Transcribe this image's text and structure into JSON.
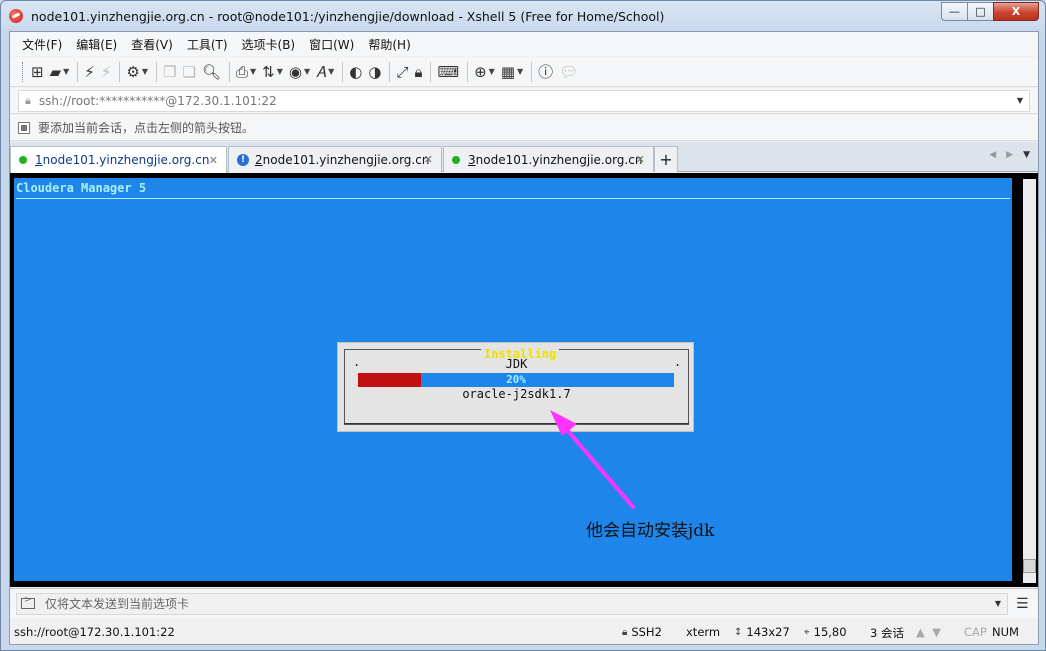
{
  "window": {
    "title": "node101.yinzhengjie.org.cn - root@node101:/yinzhengjie/download - Xshell 5 (Free for Home/School)",
    "controls": {
      "minimize": "—",
      "maximize": "□",
      "close": "X"
    }
  },
  "menubar": [
    {
      "label": "文件(F)"
    },
    {
      "label": "编辑(E)"
    },
    {
      "label": "查看(V)"
    },
    {
      "label": "工具(T)"
    },
    {
      "label": "选项卡(B)"
    },
    {
      "label": "窗口(W)"
    },
    {
      "label": "帮助(H)"
    }
  ],
  "address": {
    "value": "ssh://root:***********@172.30.1.101:22"
  },
  "hint": {
    "text": "要添加当前会话，点击左侧的箭头按钮。"
  },
  "tabs": [
    {
      "label_num": "1",
      "label_host": " node101.yinzhengjie.org.cn",
      "status": "connected",
      "active": true
    },
    {
      "label_num": "2",
      "label_host": " node101.yinzhengjie.org.cn",
      "status": "warning",
      "active": false
    },
    {
      "label_num": "3",
      "label_host": " node101.yinzhengjie.org.cn",
      "status": "connected",
      "active": false
    }
  ],
  "terminal": {
    "header": "Cloudera Manager 5",
    "dialog": {
      "title": "Installing",
      "item": "JDK",
      "progress_percent": 20,
      "progress_label": "20%",
      "package": "oracle-j2sdk1.7"
    }
  },
  "annotation": {
    "text": "他会自动安装jdk",
    "color": "#ff33ff"
  },
  "compose": {
    "placeholder": "仅将文本发送到当前选项卡"
  },
  "status": {
    "connection": "ssh://root@172.30.1.101:22",
    "protocol": "SSH2",
    "terminal_type": "xterm",
    "size": "143x27",
    "cursor": "15,80",
    "sessions": "3 会话",
    "caps": "CAP",
    "num": "NUM"
  },
  "colors": {
    "terminal_bg": "#1e86ea",
    "progress_fill": "#c01010",
    "dialog_title": "#f0e000",
    "tab_active_text": "#0d3b8a"
  }
}
